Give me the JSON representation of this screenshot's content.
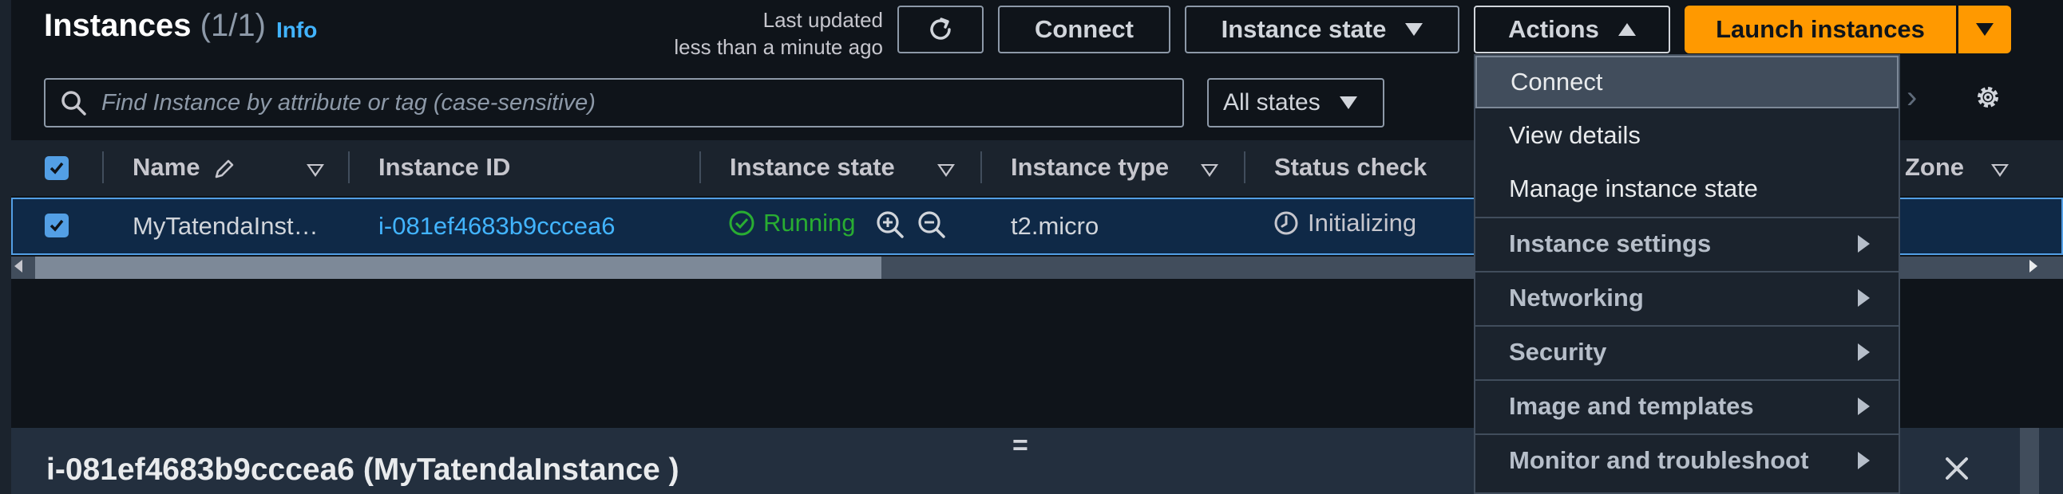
{
  "header": {
    "title": "Instances",
    "count": "(1/1)",
    "info": "Info",
    "last_updated_line1": "Last updated",
    "last_updated_line2": "less than a minute ago",
    "connect_label": "Connect",
    "instance_state_label": "Instance state",
    "actions_label": "Actions",
    "launch_label": "Launch instances"
  },
  "search": {
    "placeholder": "Find Instance by attribute or tag (case-sensitive)",
    "value": ""
  },
  "filter": {
    "selected": "All states"
  },
  "table": {
    "columns": [
      "Name",
      "Instance ID",
      "Instance state",
      "Instance type",
      "Status check",
      "Zone"
    ],
    "rows": [
      {
        "name": "MyTatendaInst…",
        "instance_id": "i-081ef4683b9cccea6",
        "state": "Running",
        "type": "t2.micro",
        "status_check": "Initializing",
        "selected": true
      }
    ]
  },
  "actions_menu": {
    "items": [
      {
        "label": "Connect",
        "highlighted": true,
        "submenu": false
      },
      {
        "label": "View details",
        "submenu": false
      },
      {
        "label": "Manage instance state",
        "submenu": false
      },
      {
        "label": "Instance settings",
        "submenu": true
      },
      {
        "label": "Networking",
        "submenu": true
      },
      {
        "label": "Security",
        "submenu": true
      },
      {
        "label": "Image and templates",
        "submenu": true
      },
      {
        "label": "Monitor and troubleshoot",
        "submenu": true
      }
    ]
  },
  "details": {
    "drag_handle": "=",
    "title": "i-081ef4683b9cccea6 (MyTatendaInstance )"
  },
  "colors": {
    "accent_orange": "#ff9900",
    "link_blue": "#42b4ff",
    "running_green": "#29ad32",
    "selection_blue": "#539fe5",
    "background": "#0f141a"
  }
}
